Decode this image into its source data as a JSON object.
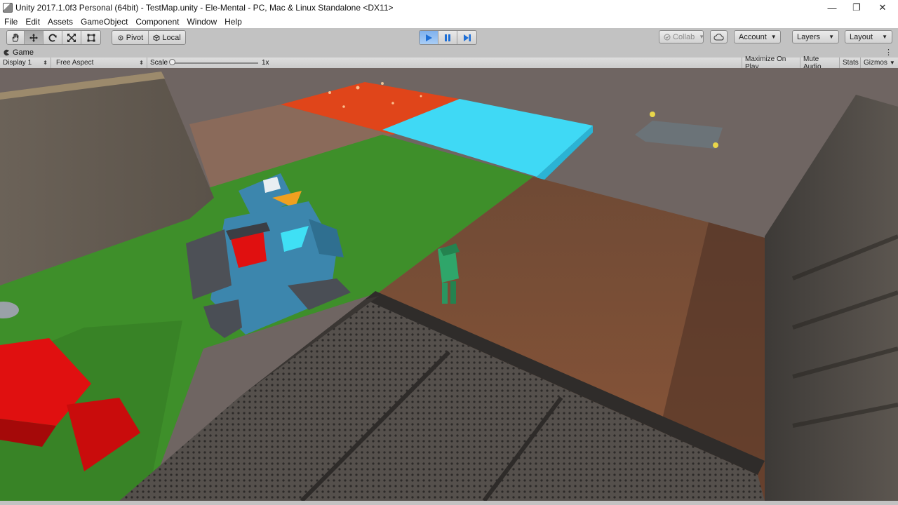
{
  "window": {
    "title": "Unity 2017.1.0f3 Personal (64bit) - TestMap.unity - Ele-Mental - PC, Mac & Linux Standalone <DX11>",
    "minimize": "—",
    "maximize": "❐",
    "close": "✕"
  },
  "menu": [
    "File",
    "Edit",
    "Assets",
    "GameObject",
    "Component",
    "Window",
    "Help"
  ],
  "toolbar": {
    "tools": [
      "hand-icon",
      "move-icon",
      "rotate-icon",
      "scale-icon",
      "rect-icon"
    ],
    "pivot": "Pivot",
    "local": "Local",
    "collab": "Collab",
    "account": "Account",
    "layers": "Layers",
    "layout": "Layout"
  },
  "tab": {
    "label": "Game"
  },
  "gamebar": {
    "display": "Display 1",
    "aspect": "Free Aspect",
    "scale_label": "Scale",
    "scale_value": "1x",
    "maximize_on_play": "Maximize On Play",
    "mute_audio": "Mute Audio",
    "stats": "Stats",
    "gizmos": "Gizmos"
  },
  "colors": {
    "play_accent": "#1e6fd6",
    "lava": "#e0451a",
    "water": "#3fd9f5",
    "grass": "#3e8f2a",
    "dirt": "#7a4a32",
    "penguin": "#3c86ad",
    "robot_red": "#e01010",
    "small_figure": "#2fa66a"
  }
}
